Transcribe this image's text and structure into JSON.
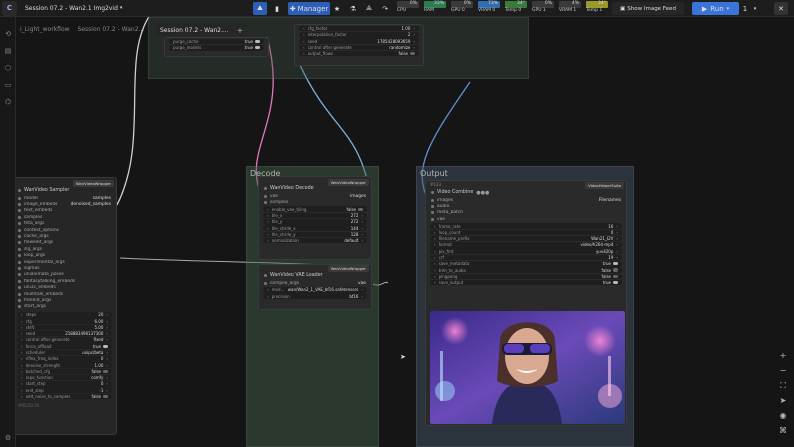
{
  "topbar": {
    "logo": "C",
    "session_title": "Session 07.2 - Wan2.1 Img2vid",
    "manager_label": "Manager",
    "show_feed_label": "Show Image Feed",
    "run_label": "Run",
    "queue_count": "1",
    "stats": [
      {
        "label": "CPU",
        "value": "0%",
        "color": "#3a3a3a"
      },
      {
        "label": "RAM",
        "value": "33%",
        "color": "#2e7d4f"
      },
      {
        "label": "GPU 0",
        "value": "0%",
        "color": "#3a3a3a"
      },
      {
        "label": "VRAM 0",
        "value": "73%",
        "color": "#2f6fb0"
      },
      {
        "label": "Temp 0",
        "value": "34°",
        "color": "#3a7a3a"
      },
      {
        "label": "GPU 1",
        "value": "0%",
        "color": "#3a3a3a"
      },
      {
        "label": "VRAM 1",
        "value": "4%",
        "color": "#3a3a3a"
      },
      {
        "label": "Temp 1",
        "value": "34°",
        "color": "#9a9a2a"
      }
    ]
  },
  "workflow_tabs": [
    {
      "label": "i_Light_workflow",
      "active": false
    },
    {
      "label": "Session 07.2 - Wan2...",
      "active": false
    },
    {
      "label": "Session 07.2 - Wan2....",
      "active": true
    }
  ],
  "groups": {
    "decode": "Decode",
    "output": "Output"
  },
  "top_left_node": {
    "rows": [
      {
        "k": "purge_cache",
        "v": "true"
      },
      {
        "k": "purge_models",
        "v": "true"
      }
    ]
  },
  "top_mid_node": {
    "rows": [
      {
        "k": "cfg_factor",
        "v": "1.00"
      },
      {
        "k": "interpolation_factor",
        "v": "2"
      },
      {
        "k": "seed",
        "v": "1785428093659"
      },
      {
        "k": "control after generate",
        "v": "randomize"
      },
      {
        "k": "output_flows",
        "v": "false"
      }
    ]
  },
  "sampler_node": {
    "badge": "WanVideoWrapper",
    "title": "WanVideo Sampler",
    "inputs": [
      {
        "k": "model",
        "v": "samples"
      },
      {
        "k": "image_embeds",
        "v": "denoised_samples"
      },
      {
        "k": "text_embeds",
        "v": ""
      },
      {
        "k": "samples",
        "v": ""
      },
      {
        "k": "feta_args",
        "v": ""
      },
      {
        "k": "context_options",
        "v": ""
      },
      {
        "k": "cache_args",
        "v": ""
      },
      {
        "k": "flowedit_args",
        "v": ""
      },
      {
        "k": "slg_args",
        "v": ""
      },
      {
        "k": "loop_args",
        "v": ""
      },
      {
        "k": "experimental_args",
        "v": ""
      },
      {
        "k": "sigmas",
        "v": ""
      },
      {
        "k": "unianimate_poses",
        "v": ""
      },
      {
        "k": "fantasytalking_embeds",
        "v": ""
      },
      {
        "k": "uni3c_embeds",
        "v": ""
      },
      {
        "k": "multitalk_embeds",
        "v": ""
      },
      {
        "k": "freeinit_args",
        "v": ""
      },
      {
        "k": "start_args",
        "v": ""
      }
    ],
    "widgets": [
      {
        "k": "steps",
        "v": "20"
      },
      {
        "k": "cfg",
        "v": "6.00"
      },
      {
        "k": "shift",
        "v": "5.00"
      },
      {
        "k": "seed",
        "v": "218883496137300"
      },
      {
        "k": "control after generate",
        "v": "fixed"
      },
      {
        "k": "force_offload",
        "v": "true"
      },
      {
        "k": "scheduler",
        "v": "unipc/beta"
      },
      {
        "k": "riflex_freq_index",
        "v": "0"
      },
      {
        "k": "denoise_strength",
        "v": "1.00"
      },
      {
        "k": "batched_cfg",
        "v": "false"
      },
      {
        "k": "rope_function",
        "v": "comfy"
      },
      {
        "k": "start_step",
        "v": "0"
      },
      {
        "k": "end_step",
        "v": "-1"
      },
      {
        "k": "add_noise_to_samples",
        "v": "false"
      }
    ],
    "footer": "#95/10.35"
  },
  "decode_node": {
    "badge": "WanVideoWrapper",
    "title": "WanVideo Decode",
    "inputs": [
      {
        "k": "vae",
        "v": "images"
      },
      {
        "k": "samples",
        "v": ""
      }
    ],
    "widgets": [
      {
        "k": "enable_vae_tiling",
        "v": "false"
      },
      {
        "k": "tile_x",
        "v": "272"
      },
      {
        "k": "tile_y",
        "v": "272"
      },
      {
        "k": "tile_stride_x",
        "v": "144"
      },
      {
        "k": "tile_stride_y",
        "v": "128"
      },
      {
        "k": "normalization",
        "v": "default"
      }
    ]
  },
  "vae_node": {
    "badge": "WanVideoWrapper",
    "title": "WanVideo VAE Loader",
    "inputs": [
      {
        "k": "compile_args",
        "v": "vae"
      }
    ],
    "widgets": [
      {
        "k": "mod...",
        "v": "wan/Wan2_1_VAE_bf16.safetensors"
      },
      {
        "k": "precision",
        "v": "bf16"
      }
    ]
  },
  "combine_node": {
    "id": "#133",
    "badge": "VideoHelperSuite",
    "title": "Video Combine",
    "inputs": [
      {
        "k": "images",
        "v": "Filenames"
      },
      {
        "k": "audio",
        "v": ""
      },
      {
        "k": "meta_batch",
        "v": ""
      },
      {
        "k": "vae",
        "v": ""
      }
    ],
    "widgets": [
      {
        "k": "frame_rate",
        "v": "16"
      },
      {
        "k": "loop_count",
        "v": "0"
      },
      {
        "k": "filename_prefix",
        "v": "Wan21_I2V"
      },
      {
        "k": "format",
        "v": "video/h264-mp4"
      },
      {
        "k": "pix_fmt",
        "v": "yuv420p"
      },
      {
        "k": "crf",
        "v": "19"
      },
      {
        "k": "save_metadata",
        "v": "true"
      },
      {
        "k": "trim_to_audio",
        "v": "false"
      },
      {
        "k": "pingpong",
        "v": "false"
      },
      {
        "k": "save_output",
        "v": "true"
      }
    ]
  },
  "icons": {
    "rail": [
      "history-icon",
      "queue-icon",
      "model-library-icon",
      "node-library-icon",
      "workflows-icon",
      "stats-icon"
    ],
    "tools": [
      "zoom-in-icon",
      "zoom-out-icon",
      "fit-view-icon",
      "pointer-icon",
      "visibility-icon",
      "link-icon"
    ]
  },
  "accent": "#2e5fb8"
}
